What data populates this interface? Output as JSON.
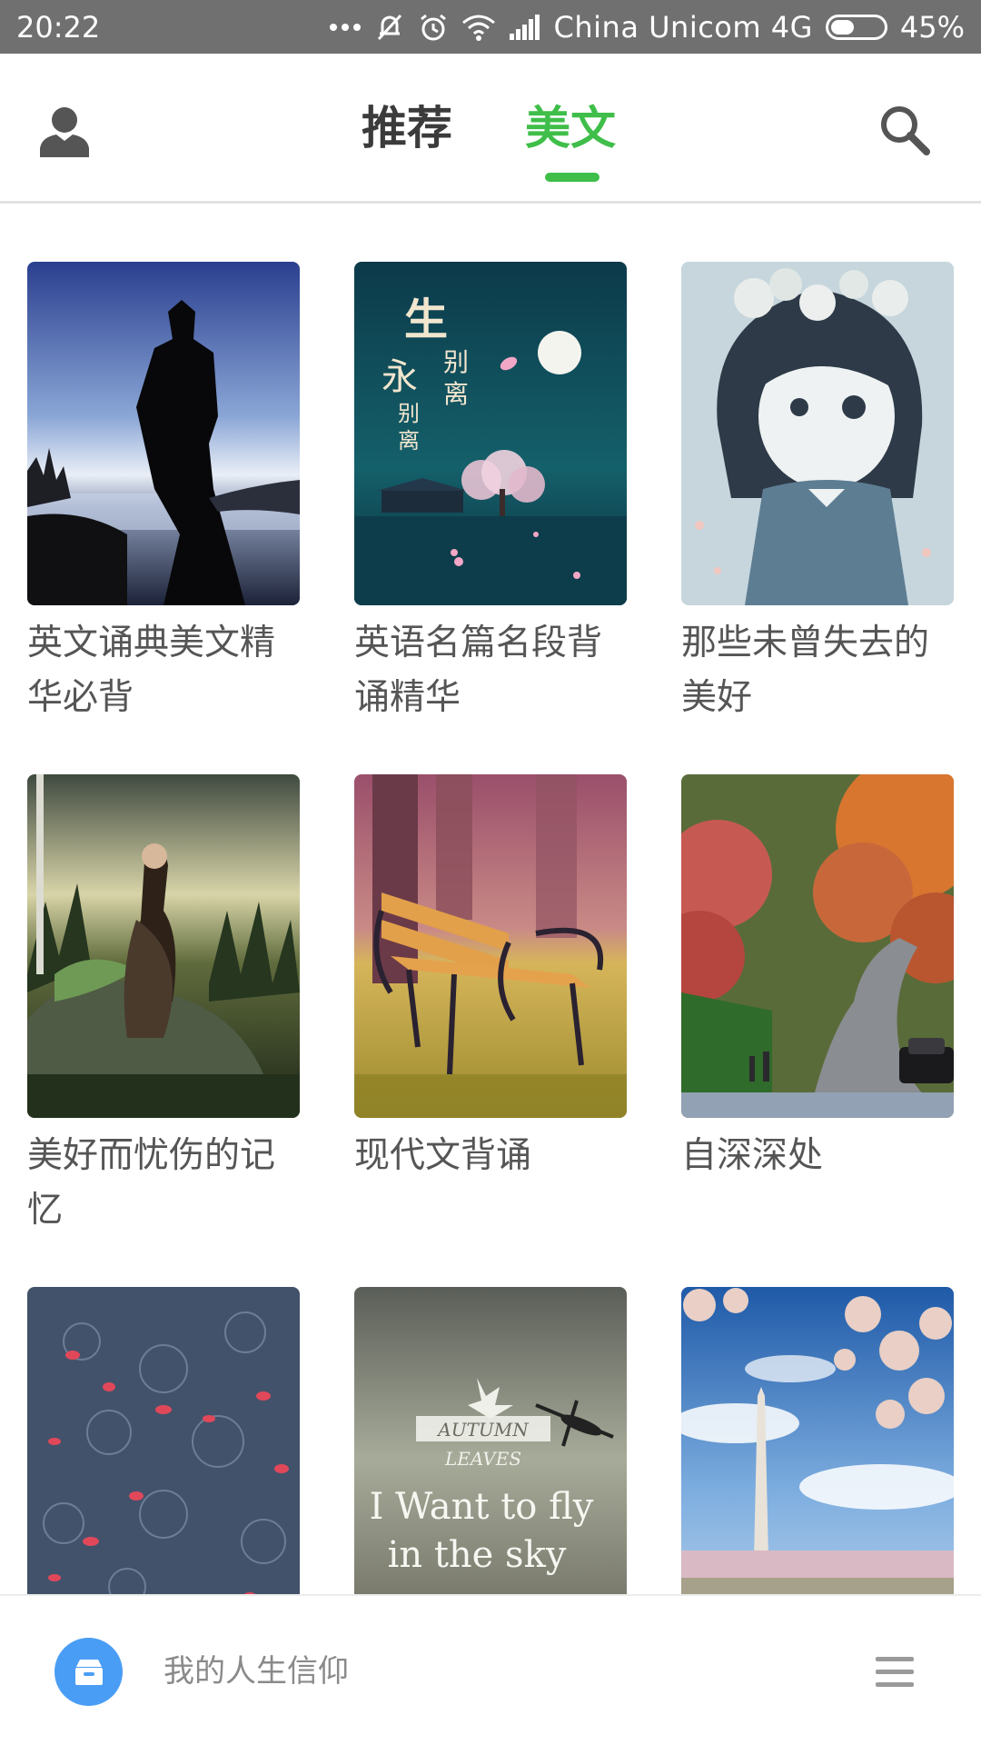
{
  "status_bar": {
    "time": "20:22",
    "carrier": "China Unicom 4G",
    "battery_percent": "45%",
    "battery_level": 0.45,
    "icons": [
      "more-dots-icon",
      "mute-icon",
      "alarm-icon",
      "wifi-icon",
      "signal-icon",
      "battery-icon"
    ]
  },
  "nav": {
    "profile_icon": "user-icon",
    "tabs": [
      {
        "label": "推荐",
        "active": false
      },
      {
        "label": "美文",
        "active": true
      }
    ],
    "search_icon": "search-icon",
    "active_color": "#3fbe4a"
  },
  "cards": [
    {
      "title": "英文诵典美文精华必背",
      "image": "silhouette-man-sunset"
    },
    {
      "title": "英语名篇名段背诵精华",
      "image": "moon-night-calligraphy",
      "image_text": "生别离 永别离"
    },
    {
      "title": "那些未曾失去的美好",
      "image": "anime-girl-flowers"
    },
    {
      "title": "美好而忧伤的记忆",
      "image": "woman-on-rock-forest"
    },
    {
      "title": "现代文背诵",
      "image": "park-bench"
    },
    {
      "title": "自深深处",
      "image": "autumn-road"
    },
    {
      "title": "",
      "image": "rain-petals"
    },
    {
      "title": "",
      "image": "autumn-leaves-plane",
      "image_text": [
        "AUTUMN",
        "LEAVES",
        "I Want to fly",
        "in the sky"
      ]
    },
    {
      "title": "",
      "image": "monument-cherry-blossom"
    }
  ],
  "player": {
    "icon": "inbox-icon",
    "title": "我的人生信仰",
    "menu_icon": "menu-icon",
    "accent_color": "#4a9df5"
  }
}
